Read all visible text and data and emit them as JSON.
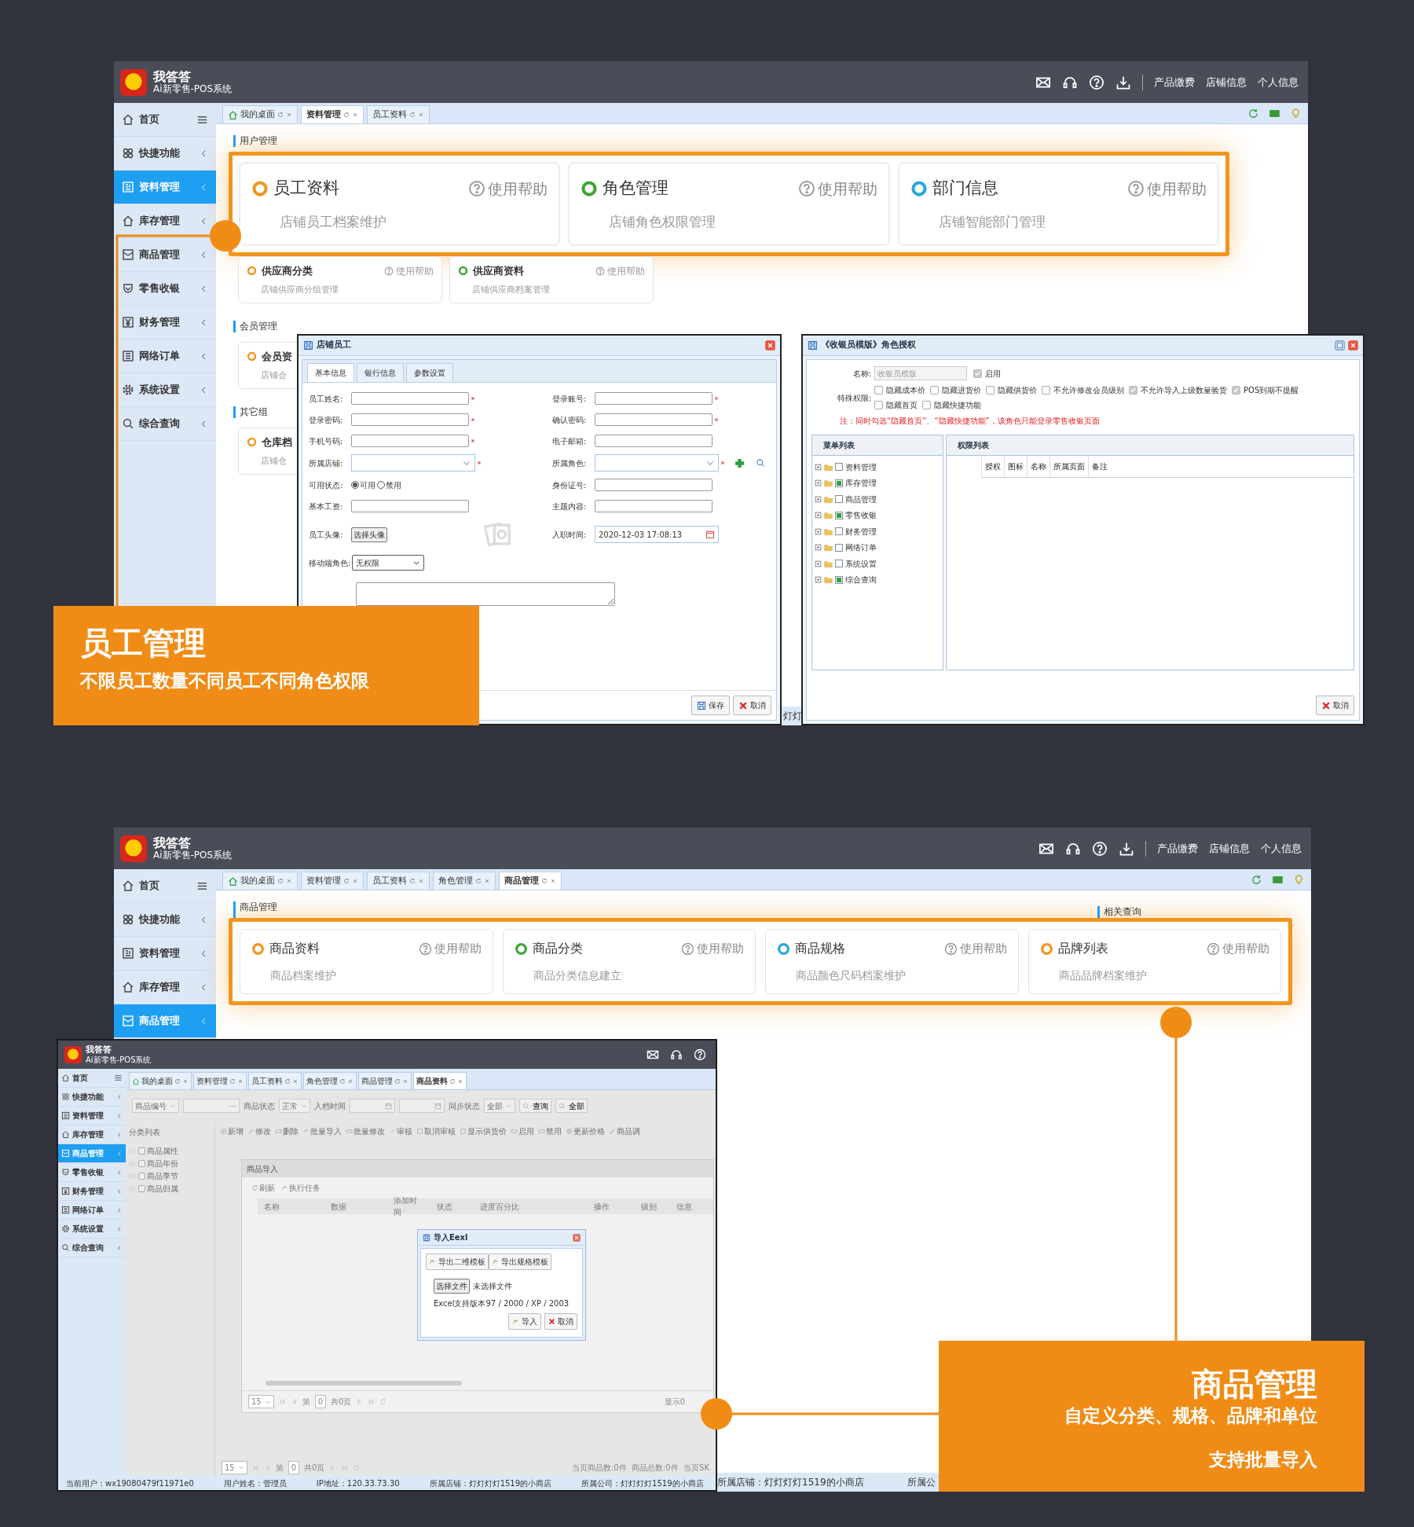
{
  "screen_1": {
    "app": {
      "name": "我答答",
      "subtitle": "Ai新零售-POS系统"
    },
    "header_links": [
      "产品缴费",
      "店铺信息",
      "个人信息"
    ],
    "sidebar": [
      {
        "label": "首页",
        "selected": false
      },
      {
        "label": "快捷功能",
        "selected": false
      },
      {
        "label": "资料管理",
        "selected": true
      },
      {
        "label": "库存管理",
        "selected": false
      },
      {
        "label": "商品管理",
        "selected": false
      },
      {
        "label": "零售收银",
        "selected": false
      },
      {
        "label": "财务管理",
        "selected": false
      },
      {
        "label": "网络订单",
        "selected": false
      },
      {
        "label": "系统设置",
        "selected": false
      },
      {
        "label": "综合查询",
        "selected": false
      }
    ],
    "tabs": [
      {
        "label": "我的桌面",
        "selected": false
      },
      {
        "label": "资料管理",
        "selected": true
      },
      {
        "label": "员工资料",
        "selected": false
      }
    ],
    "sections": [
      {
        "title": "用户管理",
        "highlighted": true,
        "cards": [
          {
            "title": "员工资料",
            "help": "使用帮助",
            "subtitle": "店铺员工档案维护",
            "color": "#f0961e"
          },
          {
            "title": "角色管理",
            "help": "使用帮助",
            "subtitle": "店铺角色权限管理",
            "color": "#3fa535"
          },
          {
            "title": "部门信息",
            "help": "使用帮助",
            "subtitle": "店铺智能部门管理",
            "color": "#2aa6dc"
          }
        ]
      },
      {
        "highlighted": false,
        "cards": [
          {
            "title": "供应商分类",
            "help": "使用帮助",
            "subtitle": "店铺供应商分组管理",
            "color": "#f0961e"
          },
          {
            "title": "供应商资料",
            "help": "使用帮助",
            "subtitle": "店铺供应商档案管理",
            "color": "#3fa535"
          }
        ]
      },
      {
        "title": "会员管理",
        "highlighted": false,
        "cards": [
          {
            "title": "会员资",
            "subtitle": "店铺会",
            "color": "#f0961e"
          }
        ]
      },
      {
        "title": "其它组",
        "highlighted": false,
        "cards": [
          {
            "title": "仓库档",
            "subtitle": "店铺仓",
            "color": "#f0961e"
          }
        ]
      }
    ],
    "status_bar": [
      "灯灯"
    ],
    "employee_dialog": {
      "title": "店铺员工",
      "tabs": [
        {
          "label": "基本信息",
          "selected": true
        },
        {
          "label": "银行信息",
          "selected": false
        },
        {
          "label": "参数设置",
          "selected": false
        }
      ],
      "fields": [
        {
          "label": "员工姓名:",
          "kind": "text",
          "required": true
        },
        {
          "label": "登录账号:",
          "kind": "text",
          "required": true
        },
        {
          "label": "登录密码:",
          "kind": "text",
          "required": true
        },
        {
          "label": "确认密码:",
          "kind": "text",
          "required": true
        },
        {
          "label": "手机号码:",
          "kind": "text",
          "required": true
        },
        {
          "label": "电子邮箱:",
          "kind": "text",
          "required": false
        },
        {
          "label": "所属店铺:",
          "kind": "select",
          "required": true
        },
        {
          "label": "所属角色:",
          "kind": "role_select",
          "required": true
        },
        {
          "label": "可用状态:",
          "kind": "radio",
          "options": [
            {
              "label": "可用",
              "selected": true
            },
            {
              "label": "禁用",
              "selected": false
            }
          ]
        },
        {
          "label": "身份证号:",
          "kind": "text",
          "required": false
        },
        {
          "label": "基本工资:",
          "kind": "text",
          "required": false
        },
        {
          "label": "主题内容:",
          "kind": "text",
          "required": false
        },
        {
          "label": "员工头像:",
          "kind": "upload",
          "button": "选择头像"
        },
        {
          "label": "入职时间:",
          "kind": "date",
          "value": "2020-12-03 17:08:13"
        },
        {
          "label": "移动端角色:",
          "kind": "dropdown",
          "value": "无权限"
        },
        {
          "kind": "textarea"
        }
      ],
      "buttons": [
        "保存",
        "取消"
      ]
    },
    "role_dialog": {
      "title": "《收银员模版》角色授权",
      "name_label": "名称:",
      "name_value": "收银员模版",
      "enabled": {
        "label": "启用",
        "checked": true
      },
      "permissions_label": "特殊权限:",
      "permissions": [
        {
          "label": "隐藏成本价",
          "checked": false
        },
        {
          "label": "隐藏进货价",
          "checked": false
        },
        {
          "label": "隐藏供货价",
          "checked": false
        },
        {
          "label": "不允许修改会员级别",
          "checked": false
        },
        {
          "label": "不允许导入上级数量验货",
          "checked": true
        },
        {
          "label": "POS到期不提醒",
          "checked": true
        },
        {
          "label": "隐藏首页",
          "checked": false
        },
        {
          "label": "隐藏快捷功能",
          "checked": false
        }
      ],
      "note": "注：同时勾选“隐藏首页”、“隐藏快捷功能”，该角色只能登录零售收银页面",
      "menu_title": "菜单列表",
      "menu": [
        {
          "label": "资料管理",
          "checked": false
        },
        {
          "label": "库存管理",
          "checked": true
        },
        {
          "label": "商品管理",
          "checked": false
        },
        {
          "label": "零售收银",
          "checked": true
        },
        {
          "label": "财务管理",
          "checked": false
        },
        {
          "label": "网络订单",
          "checked": false
        },
        {
          "label": "系统设置",
          "checked": false
        },
        {
          "label": "综合查询",
          "checked": true
        }
      ],
      "permission_title": "权限列表",
      "columns": [
        "授权",
        "图标",
        "名称",
        "所属页面",
        "备注"
      ],
      "buttons": [
        "取消"
      ]
    }
  },
  "callout_1": {
    "title": "员工管理",
    "lines": [
      "不限员工数量不同员工不同角色权限"
    ]
  },
  "screen_2": {
    "app": {
      "name": "我答答",
      "subtitle": "Ai新零售-POS系统"
    },
    "header_links": [
      "产品缴费",
      "店铺信息",
      "个人信息"
    ],
    "sidebar": [
      {
        "label": "首页",
        "selected": false
      },
      {
        "label": "快捷功能",
        "selected": false
      },
      {
        "label": "资料管理",
        "selected": false
      },
      {
        "label": "库存管理",
        "selected": false
      },
      {
        "label": "商品管理",
        "selected": true
      }
    ],
    "tabs": [
      {
        "label": "我的桌面",
        "selected": false
      },
      {
        "label": "资料管理",
        "selected": false
      },
      {
        "label": "员工资料",
        "selected": false
      },
      {
        "label": "角色管理",
        "selected": false
      },
      {
        "label": "商品管理",
        "selected": true
      }
    ],
    "section_title": "商品管理",
    "side_title": "相关查询",
    "cards": [
      {
        "title": "商品资料",
        "help": "使用帮助",
        "subtitle": "商品档案维护",
        "color": "#f0961e"
      },
      {
        "title": "商品分类",
        "help": "使用帮助",
        "subtitle": "商品分类信息建立",
        "color": "#3fa535"
      },
      {
        "title": "商品规格",
        "help": "使用帮助",
        "subtitle": "商品颜色尺码档案维护",
        "color": "#2aa6dc"
      },
      {
        "title": "品牌列表",
        "help": "使用帮助",
        "subtitle": "商品品牌档案维护",
        "color": "#f0961e"
      }
    ],
    "status_bar": [
      "所属店铺：灯灯灯灯1519的小商店",
      "所属公"
    ]
  },
  "screen_3": {
    "app": {
      "name": "我答答",
      "subtitle": "Ai新零售-POS系统"
    },
    "sidebar": [
      {
        "label": "首页",
        "selected": false
      },
      {
        "label": "快捷功能",
        "selected": false
      },
      {
        "label": "资料管理",
        "selected": false
      },
      {
        "label": "库存管理",
        "selected": false
      },
      {
        "label": "商品管理",
        "selected": true
      },
      {
        "label": "零售收银",
        "selected": false
      },
      {
        "label": "财务管理",
        "selected": false
      },
      {
        "label": "网络订单",
        "selected": false
      },
      {
        "label": "系统设置",
        "selected": false
      },
      {
        "label": "综合查询",
        "selected": false
      }
    ],
    "tabs": [
      {
        "label": "我的桌面",
        "selected": false
      },
      {
        "label": "资料管理",
        "selected": false
      },
      {
        "label": "员工资料",
        "selected": false
      },
      {
        "label": "角色管理",
        "selected": false
      },
      {
        "label": "商品管理",
        "selected": false
      },
      {
        "label": "商品资料",
        "selected": true
      }
    ],
    "filter_bar": [
      {
        "kind": "select",
        "value": "商品编号"
      },
      {
        "kind": "picker",
        "value": "···"
      },
      {
        "kind": "label",
        "value": "商品状态"
      },
      {
        "kind": "select",
        "value": "正常"
      },
      {
        "kind": "label",
        "value": "入档时间"
      },
      {
        "kind": "date"
      },
      {
        "kind": "date"
      },
      {
        "kind": "label",
        "value": "同步状态"
      },
      {
        "kind": "select",
        "value": "全部"
      },
      {
        "kind": "button",
        "value": "查询"
      },
      {
        "kind": "button",
        "value": "全部"
      }
    ],
    "toolbar": [
      "新增",
      "修改",
      "删除",
      "批量导入",
      "批量修改",
      "审核",
      "取消审核",
      "显示供货价",
      "启用",
      "禁用",
      "更新价格",
      "商品调"
    ],
    "category_title": "分类列表",
    "categories": [
      "商品属性",
      "商品年份",
      "商品季节",
      "商品归属"
    ],
    "import_panel": {
      "title": "商品导入",
      "actions": [
        "刷新",
        "执行任务"
      ],
      "columns": [
        "名称",
        "数据",
        "添加时间",
        "状态",
        "进度百分比",
        "操作",
        "级别",
        "信息"
      ],
      "pager": {
        "size": "15",
        "page_label": "第",
        "page": "0",
        "total": "共0页",
        "info": "显示0"
      }
    },
    "excel_dialog": {
      "title": "导入Eexl",
      "templates": [
        "导出二维模板",
        "导出规格模板"
      ],
      "file_button": "选择文件",
      "file_status": "未选择文件",
      "hint": "Excel支持版本97 / 2000 / XP / 2003",
      "buttons": [
        "导入",
        "取消"
      ]
    },
    "pager": {
      "size": "15",
      "page_label": "第",
      "page": "0",
      "total": "共0页",
      "info": "当页商品数:0件  商品总数:0件  当页SK"
    },
    "status_bar": [
      "当前用户：wx19080479f11971e0",
      "用户姓名：管理员",
      "IP地址：120.33.73.30",
      "所属店铺：灯灯灯灯1519的小商店",
      "所属公司：灯灯灯灯1519的小商店"
    ]
  },
  "callout_2": {
    "title": "商品管理",
    "lines": [
      "自定义分类、规格、品牌和单位",
      "支持批量导入"
    ]
  }
}
